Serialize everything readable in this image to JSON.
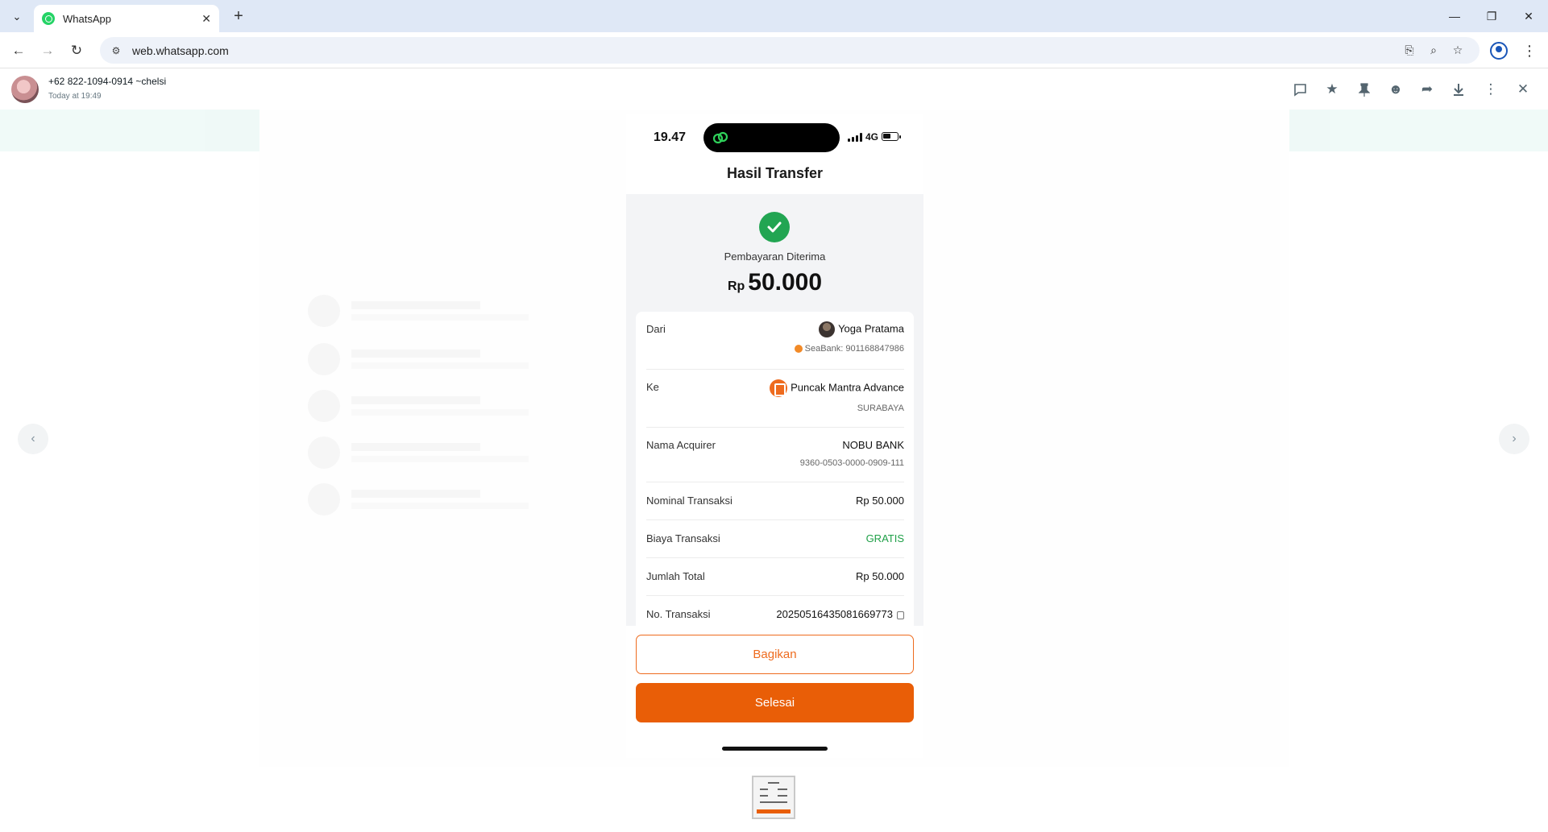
{
  "browser": {
    "tab_title": "WhatsApp",
    "url": "web.whatsapp.com"
  },
  "viewer": {
    "sender_name": "+62 822-1094-0914 ~chelsi",
    "timestamp": "Today at 19:49",
    "icons": [
      "reply-icon",
      "star-icon",
      "pin-icon",
      "react-icon",
      "forward-icon",
      "download-icon",
      "more-icon",
      "close-icon"
    ]
  },
  "receipt": {
    "status_time": "19.47",
    "network": "4G",
    "title": "Hasil Transfer",
    "payment_status": "Pembayaran Diterima",
    "currency": "Rp",
    "amount": "50.000",
    "from_label": "Dari",
    "from_name": "Yoga Pratama",
    "from_account": "SeaBank: 901168847986",
    "to_label": "Ke",
    "to_name": "Puncak Mantra Advance",
    "to_city": "SURABAYA",
    "acquirer_label": "Nama Acquirer",
    "acquirer_name": "NOBU BANK",
    "acquirer_id": "9360-0503-0000-0909-111",
    "nominal_label": "Nominal Transaksi",
    "nominal_value": "Rp 50.000",
    "fee_label": "Biaya Transaksi",
    "fee_value": "GRATIS",
    "total_label": "Jumlah Total",
    "total_value": "Rp 50.000",
    "txn_label": "No. Transaksi",
    "txn_value": "20250516435081669773",
    "share_button": "Bagikan",
    "done_button": "Selesai"
  },
  "colors": {
    "accent_orange": "#e95e07",
    "success_green": "#22a552",
    "whatsapp_green": "#25d366"
  }
}
